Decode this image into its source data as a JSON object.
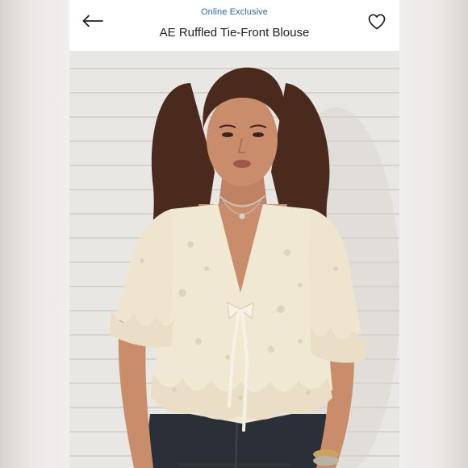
{
  "header": {
    "badge": "Online Exclusive",
    "product_title": "AE Ruffled Tie-Front Blouse",
    "back_icon": "arrow-left-icon",
    "favorite_icon": "heart-outline-icon"
  },
  "photo": {
    "colors": {
      "wall": "#e9e7e3",
      "hair": "#4a2a1c",
      "skin": "#c98d6b",
      "lace": "#f1e8d3",
      "jeans": "#2b2f38"
    }
  }
}
